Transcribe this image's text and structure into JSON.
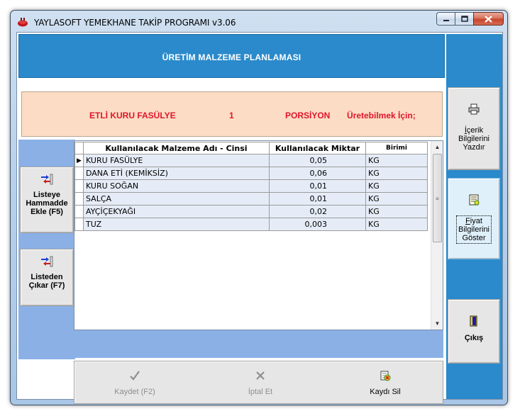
{
  "window": {
    "title": "YAYLASOFT YEMEKHANE TAKİP PROGRAMI v3.06"
  },
  "header": {
    "title": "ÜRETİM MALZEME PLANLAMASI"
  },
  "info": {
    "product": "ETLİ KURU FASÜLYE",
    "quantity": "1",
    "unit": "PORSİYON",
    "suffix": "Üretebilmek İçin;"
  },
  "left_buttons": {
    "add_label": "Listeye\nHammadde\nEkle (F5)",
    "remove_label": "Listeden\nÇıkar (F7)"
  },
  "grid": {
    "columns": [
      "Kullanılacak Malzeme Adı - Cinsi",
      "Kullanılacak Miktar",
      "Birimi"
    ],
    "rows": [
      {
        "name": "KURU FASÜLYE",
        "amount": "0,05",
        "unit": "KG"
      },
      {
        "name": "DANA ETİ (KEMİKSİZ)",
        "amount": "0,06",
        "unit": "KG"
      },
      {
        "name": "KURU SOĞAN",
        "amount": "0,01",
        "unit": "KG"
      },
      {
        "name": "SALÇA",
        "amount": "0,01",
        "unit": "KG"
      },
      {
        "name": "AYÇİÇEKYAĞI",
        "amount": "0,02",
        "unit": "KG"
      },
      {
        "name": "TUZ",
        "amount": "0,003",
        "unit": "KG"
      }
    ],
    "current_row_marker": "▶"
  },
  "bottom_buttons": {
    "save": "Kaydet (F2)",
    "cancel": "İptal Et",
    "delete": "Kaydı Sil"
  },
  "right_buttons": {
    "print_underlined": "İ",
    "print_rest": "çerik\nBilgilerini\nYazdır",
    "price_underlined": "F",
    "price_rest": "iyat\nBilgilerini\nGöster",
    "exit": "Çıkış"
  },
  "colors": {
    "panel_blue": "#2a8acb",
    "light_blue": "#8ab0e6",
    "info_bg": "#fcdcc4",
    "info_text": "#e0152a",
    "row_bg": "#e6ecf7"
  }
}
